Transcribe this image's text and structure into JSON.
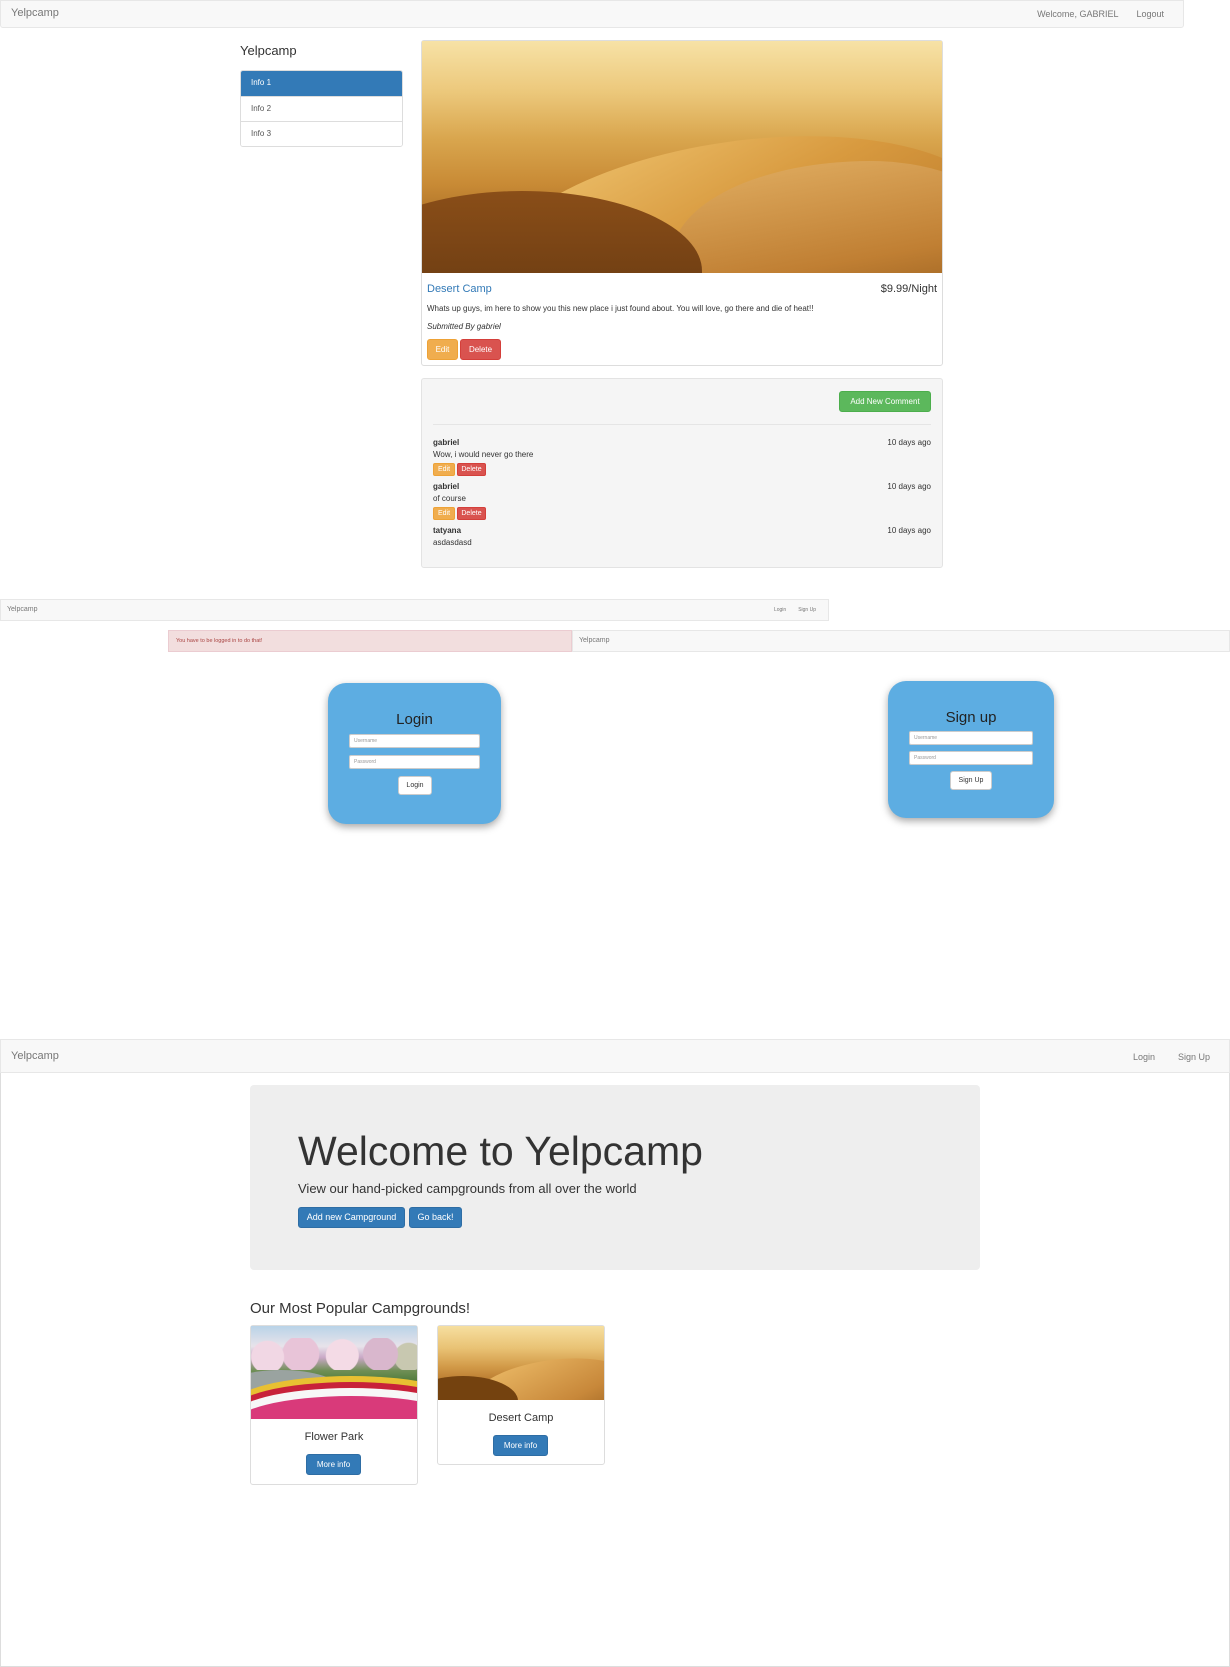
{
  "show_page": {
    "navbar": {
      "brand": "Yelpcamp",
      "welcome": "Welcome, GABRIEL",
      "logout": "Logout"
    },
    "sidebar": {
      "title": "Yelpcamp",
      "items": [
        {
          "label": "Info 1"
        },
        {
          "label": "Info 2"
        },
        {
          "label": "Info 3"
        }
      ]
    },
    "campground": {
      "name": "Desert Camp",
      "price": "$9.99/Night",
      "description": "Whats up guys, im here to show you this new place i just found about. You will love, go there and die of heat!!",
      "submitted_by": "Submitted By gabriel",
      "edit_label": "Edit",
      "delete_label": "Delete"
    },
    "comments_section": {
      "add_label": "Add New Comment",
      "comments": [
        {
          "author": "gabriel",
          "time": "10 days ago",
          "text": "Wow, i would never go there",
          "edit": "Edit",
          "delete": "Delete"
        },
        {
          "author": "gabriel",
          "time": "10 days ago",
          "text": "of course",
          "edit": "Edit",
          "delete": "Delete"
        },
        {
          "author": "tatyana",
          "time": "10 days ago",
          "text": "asdasdasd"
        }
      ]
    }
  },
  "auth_pages": {
    "navbar": {
      "brand": "Yelpcamp",
      "login": "Login",
      "signup": "Sign Up"
    },
    "flash_error": "You have to be logged in to do that!",
    "navbar_signup_brand": "Yelpcamp",
    "login_form": {
      "title": "Login",
      "username_placeholder": "Username",
      "password_placeholder": "Password",
      "submit": "Login"
    },
    "signup_form": {
      "title": "Sign up",
      "username_placeholder": "Username",
      "password_placeholder": "Password",
      "submit": "Sign Up"
    }
  },
  "landing_page": {
    "navbar": {
      "brand": "Yelpcamp",
      "login": "Login",
      "signup": "Sign Up"
    },
    "jumbotron": {
      "heading": "Welcome to Yelpcamp",
      "subheading": "View our hand-picked campgrounds from all over the world",
      "add_button": "Add new Campground",
      "back_button": "Go back!"
    },
    "popular_heading": "Our Most Popular Campgrounds!",
    "cards": [
      {
        "name": "Flower Park",
        "button": "More info"
      },
      {
        "name": "Desert Camp",
        "button": "More info"
      }
    ]
  },
  "colors": {
    "primary": "#337ab7",
    "warning": "#f0ad4e",
    "danger": "#d9534f",
    "success": "#5cb85c",
    "auth_card": "#5dade2"
  }
}
